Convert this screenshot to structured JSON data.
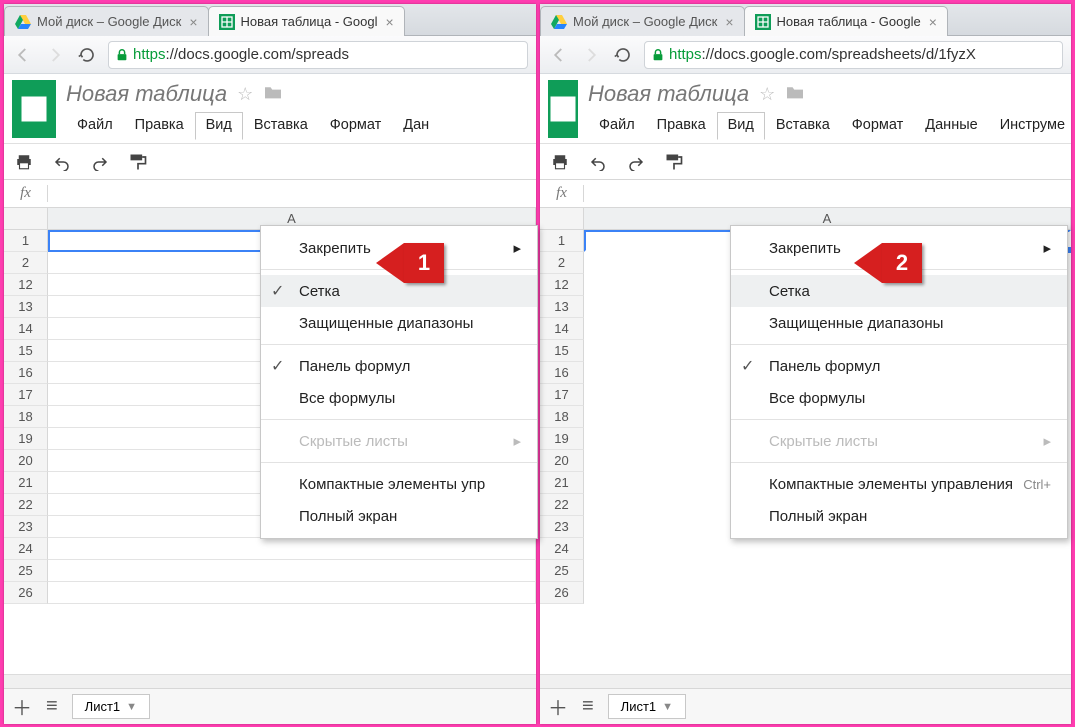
{
  "left": {
    "tabs": [
      {
        "label": "Мой диск – Google Диск",
        "icon": "drive"
      },
      {
        "label": "Новая таблица - Googl",
        "icon": "sheets"
      }
    ],
    "url_https": "https",
    "url_rest": "://docs.google.com/spreads",
    "doc_title": "Новая таблица",
    "menu": {
      "file": "Файл",
      "edit": "Правка",
      "view": "Вид",
      "insert": "Вставка",
      "format": "Формат",
      "data": "Дан"
    },
    "col_a": "A",
    "rows": [
      "1",
      "2",
      "12",
      "13",
      "14",
      "15",
      "16",
      "17",
      "18",
      "19",
      "20",
      "21",
      "22",
      "23",
      "24",
      "25",
      "26"
    ],
    "hide_grid": false,
    "sheet_tab": "Лист1",
    "menu_items": {
      "freeze": "Закрепить",
      "grid": "Сетка",
      "protected": "Защищенные диапазоны",
      "formula_bar": "Панель формул",
      "all_formulas": "Все формулы",
      "hidden_sheets": "Скрытые листы",
      "compact": "Компактные элементы упр",
      "fullscreen": "Полный экран"
    },
    "grid_checked": true,
    "callout_num": "1"
  },
  "right": {
    "tabs": [
      {
        "label": "Мой диск – Google Диск",
        "icon": "drive"
      },
      {
        "label": "Новая таблица - Google",
        "icon": "sheets"
      }
    ],
    "url_https": "https",
    "url_rest": "://docs.google.com/spreadsheets/d/1fyzX",
    "doc_title": "Новая таблица",
    "menu": {
      "file": "Файл",
      "edit": "Правка",
      "view": "Вид",
      "insert": "Вставка",
      "format": "Формат",
      "data": "Данные",
      "tools": "Инструме"
    },
    "col_a": "A",
    "rows": [
      "1",
      "2",
      "12",
      "13",
      "14",
      "15",
      "16",
      "17",
      "18",
      "19",
      "20",
      "21",
      "22",
      "23",
      "24",
      "25",
      "26"
    ],
    "hide_grid": true,
    "sheet_tab": "Лист1",
    "menu_items": {
      "freeze": "Закрепить",
      "grid": "Сетка",
      "protected": "Защищенные диапазоны",
      "formula_bar": "Панель формул",
      "all_formulas": "Все формулы",
      "hidden_sheets": "Скрытые листы",
      "compact": "Компактные элементы управления",
      "compact_shortcut": "Ctrl+",
      "fullscreen": "Полный экран"
    },
    "grid_checked": false,
    "callout_num": "2"
  }
}
